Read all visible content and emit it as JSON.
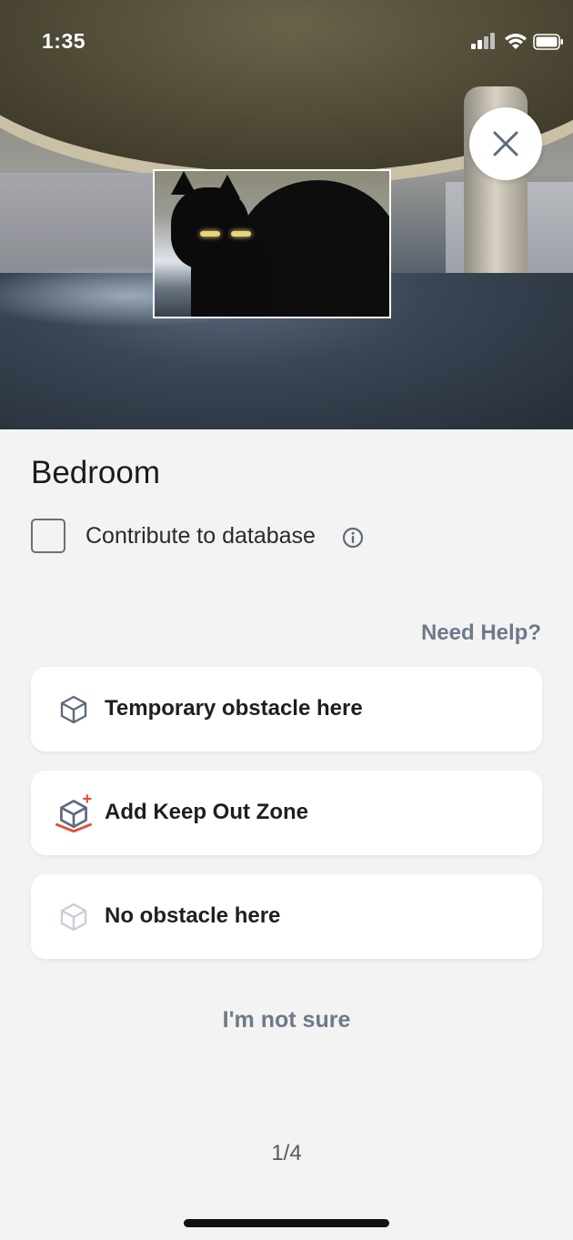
{
  "status_bar": {
    "time": "1:35",
    "signal_icon": "signal-icon",
    "wifi_icon": "wifi-icon",
    "battery_icon": "battery-icon"
  },
  "photo": {
    "description_icon": "camera-photo",
    "close_icon": "close-icon"
  },
  "room": {
    "title": "Bedroom"
  },
  "contribute": {
    "label": "Contribute to database",
    "checked": false,
    "info_icon": "info-icon"
  },
  "help": {
    "label": "Need Help?"
  },
  "options": [
    {
      "label": "Temporary obstacle here",
      "icon": "cube-icon"
    },
    {
      "label": "Add Keep Out Zone",
      "icon": "keep-out-zone-icon"
    },
    {
      "label": "No obstacle here",
      "icon": "cube-outline-icon"
    }
  ],
  "not_sure": {
    "label": "I'm not sure"
  },
  "pager": {
    "text": "1/4"
  },
  "colors": {
    "accent": "#6e7a8a",
    "keep_out": "#e0533b",
    "background": "#f3f3f3"
  }
}
